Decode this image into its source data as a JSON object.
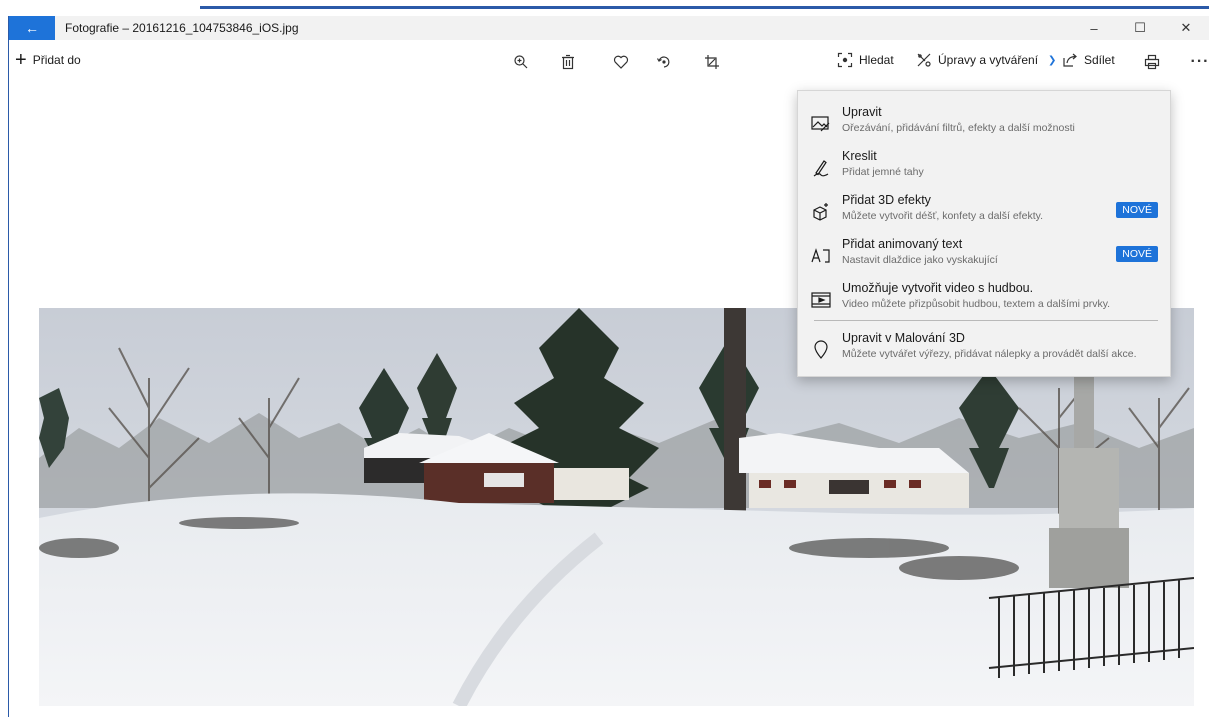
{
  "window": {
    "title": "Fotografie – 20161216_104753846_iOS.jpg",
    "back_glyph": "←",
    "minimize_glyph": "–",
    "maximize_glyph": "☐",
    "close_glyph": "✕"
  },
  "toolbar": {
    "add_to_label": "Přidat do",
    "search_label": "Hledat",
    "edit_create_label": "Úpravy a vytváření",
    "share_label": "Sdílet",
    "more_glyph": "···",
    "icons": [
      "zoom-in-icon",
      "delete-icon",
      "favorite-icon",
      "rotate-icon",
      "crop-icon",
      "print-icon"
    ]
  },
  "menu": {
    "items": [
      {
        "title": "Upravit",
        "subtitle": "Ořezávání, přidávání filtrů, efekty a další možnosti",
        "icon": "edit-image-icon"
      },
      {
        "title": "Kreslit",
        "subtitle": "Přidat jemné tahy",
        "icon": "pen-icon"
      },
      {
        "title": "Přidat 3D efekty",
        "subtitle": "Můžete vytvořit déšť, konfety a další efekty.",
        "icon": "cube-sparkle-icon",
        "badge": "NOVÉ"
      },
      {
        "title": "Přidat animovaný text",
        "subtitle": "Nastavit dlaždice jako vyskakující",
        "icon": "animated-text-icon",
        "badge": "NOVÉ"
      },
      {
        "title": "Umožňuje vytvořit video s hudbou.",
        "subtitle": "Video můžete přizpůsobit hudbou, textem a dalšími prvky.",
        "icon": "video-icon"
      },
      {
        "title": "Upravit v Malování 3D",
        "subtitle": "Můžete vytvářet výřezy, přidávat nálepky a provádět další akce.",
        "icon": "paint3d-icon"
      }
    ]
  },
  "colors": {
    "accent": "#1e73d9",
    "titlebar_bg": "#f2f2f2",
    "menu_bg": "#f2f2f2"
  }
}
